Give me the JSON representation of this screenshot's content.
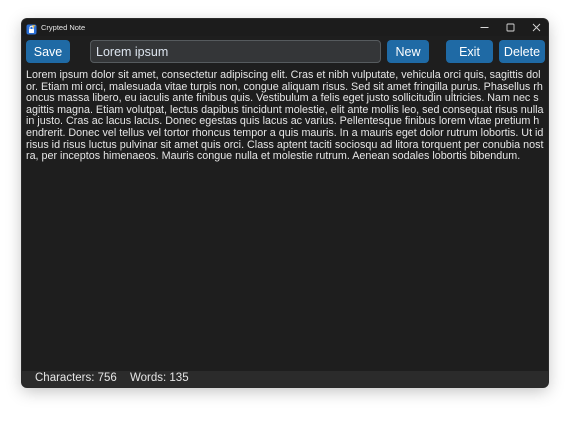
{
  "window": {
    "title": "Crypted Note",
    "icon": "app-lock-icon",
    "controls": {
      "minimize_icon": "minimize-icon",
      "maximize_icon": "maximize-icon",
      "close_icon": "close-icon"
    }
  },
  "toolbar": {
    "save_label": "Save",
    "note_title_value": "Lorem ipsum",
    "new_label": "New",
    "exit_label": "Exit",
    "delete_label": "Delete"
  },
  "editor": {
    "content": "Lorem ipsum dolor sit amet, consectetur adipiscing elit. Cras et nibh vulputate, vehicula orci quis, sagittis dolor. Etiam mi orci, malesuada vitae turpis non, congue aliquam risus. Sed sit amet fringilla purus. Phasellus rhoncus massa libero, eu iaculis ante finibus quis. Vestibulum a felis eget justo sollicitudin ultricies. Nam nec sagittis magna. Etiam volutpat, lectus dapibus tincidunt molestie, elit ante mollis leo, sed consequat risus nulla in justo. Cras ac lacus lacus. Donec egestas quis lacus ac varius. Pellentesque finibus lorem vitae pretium hendrerit. Donec vel tellus vel tortor rhoncus tempor a quis mauris. In a mauris eget dolor rutrum lobortis. Ut id risus id risus luctus pulvinar sit amet quis orci. Class aptent taciti sociosqu ad litora torquent per conubia nostra, per inceptos himenaeos. Mauris congue nulla et molestie rutrum. Aenean sodales lobortis bibendum."
  },
  "status": {
    "characters": "Characters: 756",
    "words": "Words: 135"
  },
  "colors": {
    "window_bg": "#1e1e1e",
    "button_accent": "#1f6aa5",
    "input_bg": "#343638",
    "status_bg": "#2b2b2b",
    "text": "#e6e6e6"
  }
}
